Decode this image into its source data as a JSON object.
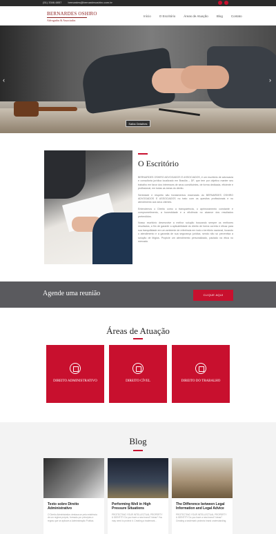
{
  "topbar": {
    "phone": "(51) 3346-6857",
    "email": "bernardes@bernardesoshiro.com.br"
  },
  "header": {
    "logo_name": "BERNARDES OSHIRO",
    "logo_tagline": "Advogados & Associados",
    "nav": [
      "Início",
      "O Escritório",
      "Áreas de Atuação",
      "Blog",
      "Contato"
    ]
  },
  "hero": {
    "button": "Saiba Detalhes",
    "prev_icon": "‹",
    "next_icon": "›"
  },
  "office": {
    "title": "O Escritório",
    "paragraphs": [
      "BERNARDES OSHIRO ADVOGADOS E ASSOCIADOS, é um escritório de advocacia e consultoria jurídica localizado em Brasília – DF, que tem por objetivo manter seu trabalho em favor dos interesses de seus constituintes, de forma dedicada, eficiente e profissional, em todas as áreas do direito.",
      "Seriedade e respeito são fundamentos essenciais do BERNARDES OSHIRO ADVOGADOS E ASSOCIADOS no trato com os quesitos profissionais e no atendimento aos seus clientes.",
      "Entendemos o Direito como a transparência, o aprimoramento constante e comprometimento, a honestidade e a eficiência no alcance dos resultados pretendidos.",
      "Nosso escritório desenvolve a melhor solução buscando sempre os melhores resultados, a fim de garantir a aplicabilidade do direito de forma correta e eficaz para sua tranquilidade em um ambiente de referência em todo o território nacional, focando o atendimento e a garantia de sua segurança jurídica, sendo não só preventiva a solução de litígios. Propicie um atendimento personalizado, pautado na ética no mercado."
    ]
  },
  "agende": {
    "title": "Agende uma reunião",
    "cta": "CLIQUE AQUI"
  },
  "areas": {
    "title": "Áreas de Atuação",
    "items": [
      {
        "label": "DIREITO ADMINISTRATIVO",
        "icon": "scale-person-icon"
      },
      {
        "label": "DIREITO CÍVEL",
        "icon": "hand-document-icon"
      },
      {
        "label": "DIREITO DO TRABALHO",
        "icon": "handshake-icon"
      }
    ]
  },
  "blog": {
    "title": "Blog",
    "posts": [
      {
        "title": "Texto sobre Direito Administrativo",
        "excerpt": "O Direito Administrativo destaca-se pela existência de um regime próprio, formado por princípios e regras que se aplicam à Administração Pública."
      },
      {
        "title": "Performing Well in High Pressure Situations",
        "excerpt": "PROTECTING YOUR INTELLECTUAL PROPERTY & IDENTITY Do you have a new brand? Ideas? You may need to protect it. Creating a trademark..."
      },
      {
        "title": "The Difference between Legal Information and Legal Advice",
        "excerpt": "PROTECTING YOUR INTELLECTUAL PROPERTY & IDENTITY Do you have a new brand? Ideas? Creating a trademark protects brand understanding."
      }
    ]
  },
  "colors": {
    "accent": "#c8102e",
    "dark_band": "#5a5a5e",
    "topbar": "#2b2b2b"
  }
}
